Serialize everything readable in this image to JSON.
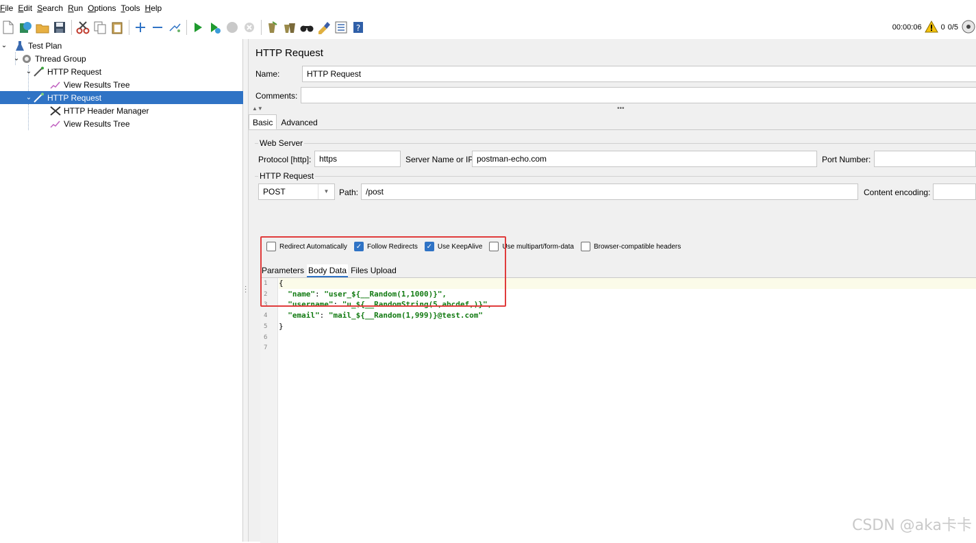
{
  "menu": [
    {
      "mn": "F",
      "rest": "ile"
    },
    {
      "mn": "E",
      "rest": "dit"
    },
    {
      "mn": "S",
      "rest": "earch"
    },
    {
      "mn": "R",
      "rest": "un"
    },
    {
      "mn": "O",
      "rest": "ptions"
    },
    {
      "mn": "T",
      "rest": "ools"
    },
    {
      "mn": "H",
      "rest": "elp"
    }
  ],
  "toolbar": {
    "timer": "00:00:06",
    "warnings": "0",
    "threads": "0/5"
  },
  "tree": {
    "items": [
      {
        "label": "Test Plan",
        "icon": "flask-icon"
      },
      {
        "label": "Thread Group",
        "icon": "gear-icon"
      },
      {
        "label": "HTTP Request",
        "icon": "pipette-icon"
      },
      {
        "label": "View Results Tree",
        "icon": "chart-icon"
      },
      {
        "label": "HTTP Request",
        "icon": "pipette-icon"
      },
      {
        "label": "HTTP Header Manager",
        "icon": "wrench-icon"
      },
      {
        "label": "View Results Tree",
        "icon": "chart-icon"
      }
    ]
  },
  "panel": {
    "title": "HTTP Request",
    "name_label": "Name:",
    "name_value": "HTTP Request",
    "comments_label": "Comments:",
    "comments_value": "",
    "tabs": [
      "Basic",
      "Advanced"
    ],
    "web_server_title": "Web Server",
    "protocol_label": "Protocol [http]:",
    "protocol_value": "https",
    "server_label": "Server Name or IP:",
    "server_value": "postman-echo.com",
    "port_label": "Port Number:",
    "port_value": "",
    "http_request_title": "HTTP Request",
    "method_value": "POST",
    "path_label": "Path:",
    "path_value": "/post",
    "encoding_label": "Content encoding:",
    "encoding_value": "",
    "checkboxes": [
      {
        "label": "Redirect Automatically",
        "checked": false
      },
      {
        "label": "Follow Redirects",
        "checked": true
      },
      {
        "label": "Use KeepAlive",
        "checked": true
      },
      {
        "label": "Use multipart/form-data",
        "checked": false
      },
      {
        "label": "Browser-compatible headers",
        "checked": false
      }
    ],
    "subtabs": [
      "Parameters",
      "Body Data",
      "Files Upload"
    ]
  },
  "body": {
    "line_numbers": [
      "1",
      "2",
      "3",
      "4",
      "5",
      "6",
      "7"
    ],
    "lines": [
      {
        "key": "",
        "val": "{"
      },
      {
        "key": "\"name\"",
        "val": "\"user_${__Random(1,1000)}\","
      },
      {
        "key": "\"username\"",
        "val": "\"u_${__RandomString(5,abcdef,)}\","
      },
      {
        "key": "\"email\"",
        "val": "\"mail_${__Random(1,999)}@test.com\""
      },
      {
        "key": "",
        "val": "}"
      }
    ]
  },
  "watermark": "CSDN @aka卡卡"
}
